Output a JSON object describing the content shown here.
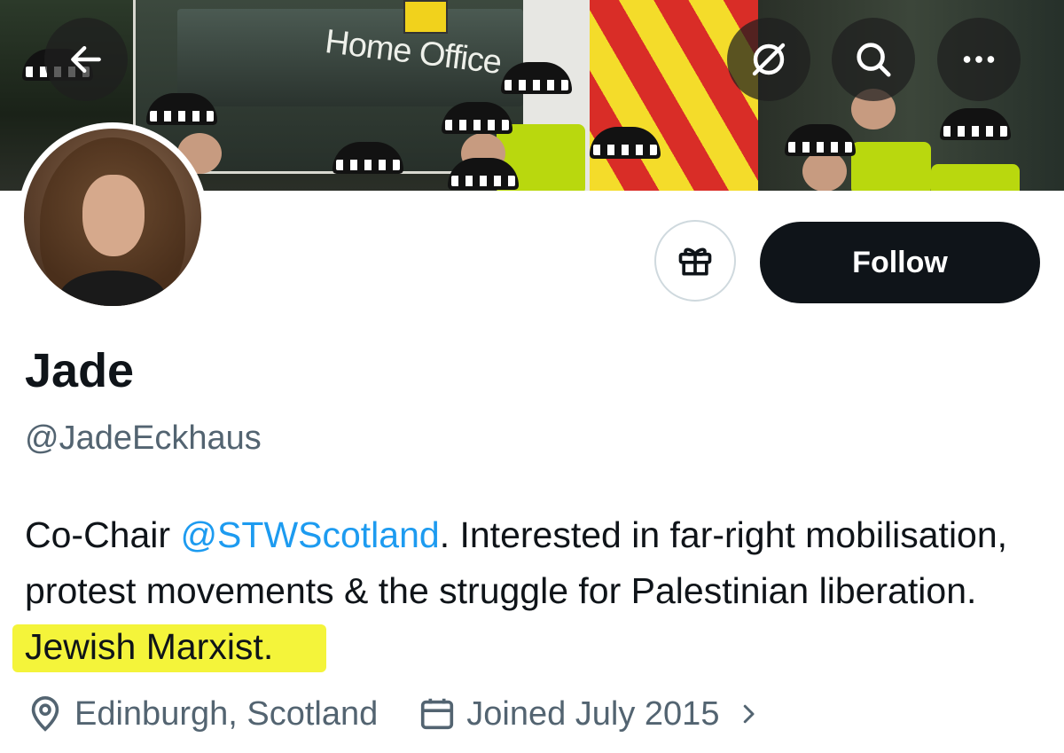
{
  "banner": {
    "sign_text": "Home Office",
    "back_icon": "arrow-left-icon",
    "grok_icon": "grok-icon",
    "search_icon": "search-icon",
    "more_icon": "more-horizontal-icon"
  },
  "profile": {
    "display_name": "Jade",
    "handle": "@JadeEckhaus",
    "bio": {
      "prefix": "Co-Chair ",
      "mention": "@STWScotland",
      "middle": ". Interested in far-right mobilisation, protest movements & the struggle for Palestinian liberation.",
      "highlighted": "Jewish Marxist."
    },
    "location": "Edinburgh, Scotland",
    "joined": "Joined July 2015"
  },
  "actions": {
    "gift_icon": "gift-icon",
    "follow_label": "Follow"
  },
  "colors": {
    "accent": "#1d9bf0",
    "secondary_text": "#536471",
    "highlight": "#f4f43a",
    "follow_bg": "#0f1419"
  }
}
